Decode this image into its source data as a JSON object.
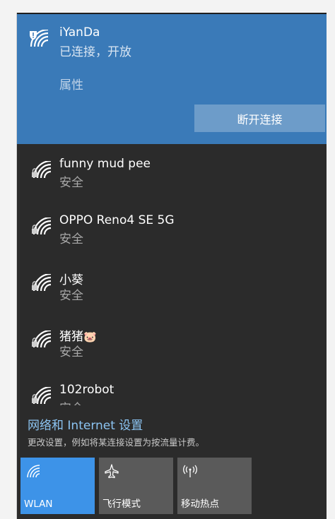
{
  "colors": {
    "flyout_bg": "#2b2b2b",
    "active_bg": "#3a7ab8",
    "disconnect_bg": "#6d9cc9",
    "tile_on": "#3d93e8",
    "tile_off": "#5a5a5a",
    "link": "#8cc4f2"
  },
  "active_network": {
    "name": "iYanDa",
    "status": "已连接，开放",
    "properties_label": "属性",
    "disconnect_label": "断开连接",
    "icon": "wifi-warning-icon"
  },
  "networks": [
    {
      "name": "funny mud pee",
      "status": "安全",
      "icon": "wifi-secure-icon"
    },
    {
      "name": "OPPO Reno4 SE 5G",
      "status": "安全",
      "icon": "wifi-secure-icon"
    },
    {
      "name": "小葵",
      "status": "安全",
      "icon": "wifi-secure-icon"
    },
    {
      "name": "猪猪",
      "emoji": "🐷",
      "status": "安全",
      "icon": "wifi-secure-icon"
    },
    {
      "name": "102robot",
      "status": "安全",
      "icon": "wifi-secure-icon"
    }
  ],
  "settings": {
    "link": "网络和 Internet 设置",
    "description": "更改设置，例如将某连接设置为按流量计费。"
  },
  "quick_actions": [
    {
      "label": "WLAN",
      "icon": "wifi-icon",
      "active": true
    },
    {
      "label": "飞行模式",
      "icon": "airplane-icon",
      "active": false
    },
    {
      "label": "移动热点",
      "icon": "hotspot-icon",
      "active": false
    }
  ]
}
